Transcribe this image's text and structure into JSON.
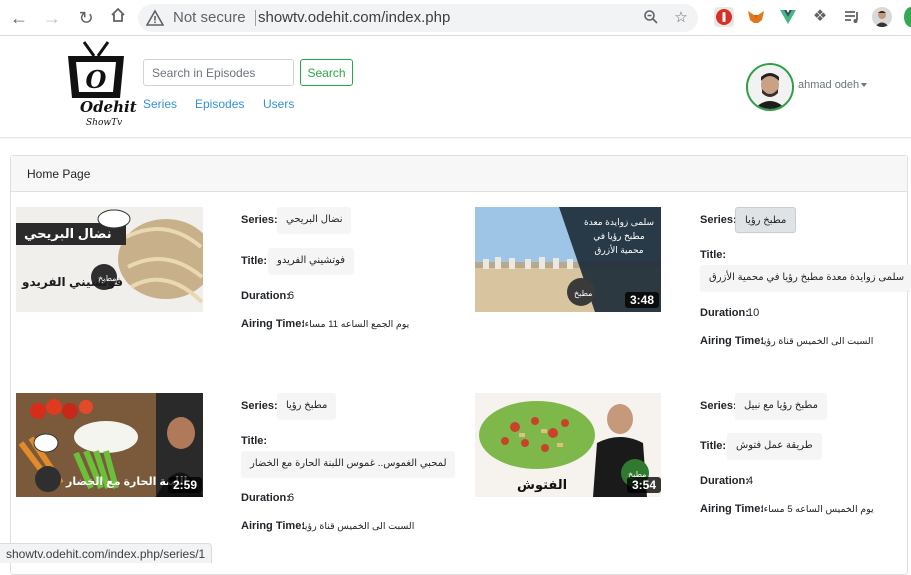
{
  "browser": {
    "security_label": "Not secure",
    "url": "showtv.odehit.com/index.php"
  },
  "site": {
    "logo_name": "Odehit",
    "logo_sub": "ShowTv",
    "search_placeholder": "Search in Episodes",
    "search_button": "Search",
    "nav": [
      "Series",
      "Episodes",
      "Users"
    ],
    "user_name": "ahmad odeh"
  },
  "card": {
    "header": "Home Page",
    "labels": {
      "series": "Series:",
      "title": "Title:",
      "duration": "Duration:",
      "airing": "Airing Time:"
    },
    "episodes": [
      {
        "series": "نضال البريحي",
        "title": "فوتشيني الفريدو",
        "duration": "6",
        "airing": "يوم الجمع الساعه 11 مساءا",
        "thumb_caption": "فوتشيني الفريدو",
        "thumb_banner": "نضال البريحي",
        "badge": ""
      },
      {
        "series": "مطبخ رؤيا",
        "title": "سلمى زوايدة معدة مطبخ رؤيا في محمية الأزرق",
        "duration": "10",
        "airing": "السبت الى الخميس قناة رؤيا",
        "thumb_caption": "سلمى زوايدة معدة مطبخ رؤيا في محمية الأزرق",
        "thumb_banner": "",
        "badge": "3:48"
      },
      {
        "series": "مطبخ رؤيا",
        "title": "لمحبي الغموس.. غموس اللبنة الحارة مع الخضار",
        "duration": "6",
        "airing": "السبت الى الخميس قناة رؤيا",
        "thumb_caption": "اللبنة الحارة مع الخضار",
        "thumb_banner": "",
        "badge": "2:59"
      },
      {
        "series": "مطبخ رؤيا مع نبيل",
        "title": "طريقة عمل فتوش",
        "duration": "4",
        "airing": "يوم الخميس الساعه 5 مساءا",
        "thumb_caption": "الفتوش",
        "thumb_banner": "",
        "badge": "3:54"
      }
    ]
  },
  "status_bar": "showtv.odehit.com/index.php/series/1",
  "colors": {
    "link": "#3490dc",
    "success": "#28a745",
    "avatar_ring": "#2f9e44"
  }
}
